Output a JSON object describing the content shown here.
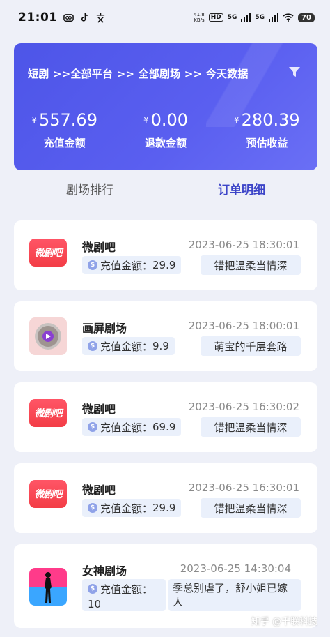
{
  "status_bar": {
    "time": "21:01",
    "net_speed_value": "41.8",
    "net_speed_unit": "KB/s",
    "hd_label": "HD",
    "sig1": "5G",
    "sig2": "5G",
    "battery": "70"
  },
  "summary": {
    "breadcrumb": "短剧 >>全部平台 >> 全部剧场 >> 今天数据",
    "currency_symbol": "¥",
    "stats": [
      {
        "amount": "557.69",
        "label": "充值金额"
      },
      {
        "amount": "0.00",
        "label": "退款金额"
      },
      {
        "amount": "280.39",
        "label": "预估收益"
      }
    ]
  },
  "tabs": [
    {
      "label": "剧场排行",
      "active": false
    },
    {
      "label": "订单明细",
      "active": true
    }
  ],
  "orders": [
    {
      "app": "微剧吧",
      "logo_text": "微剧吧",
      "time": "2023-06-25 18:30:01",
      "amount_label": "充值金额：",
      "amount": "29.9",
      "drama": "错把温柔当情深"
    },
    {
      "app": "画屏剧场",
      "logo_text": "",
      "time": "2023-06-25 18:00:01",
      "amount_label": "充值金额：",
      "amount": "9.9",
      "drama": "萌宝的千层套路"
    },
    {
      "app": "微剧吧",
      "logo_text": "微剧吧",
      "time": "2023-06-25 16:30:02",
      "amount_label": "充值金额：",
      "amount": "69.9",
      "drama": "错把温柔当情深"
    },
    {
      "app": "微剧吧",
      "logo_text": "微剧吧",
      "time": "2023-06-25 16:30:01",
      "amount_label": "充值金额：",
      "amount": "29.9",
      "drama": "错把温柔当情深"
    },
    {
      "app": "女神剧场",
      "logo_text": "",
      "time": "2023-06-25 14:30:04",
      "amount_label": "充值金额：",
      "amount": "10",
      "drama": "季总别虐了，舒小姐已嫁人"
    }
  ],
  "watermark": "知乎 @千联科技",
  "colors": {
    "accent": "#4d55e8",
    "active_tab": "#3d45c8",
    "pill_bg": "#eaf0fb"
  }
}
